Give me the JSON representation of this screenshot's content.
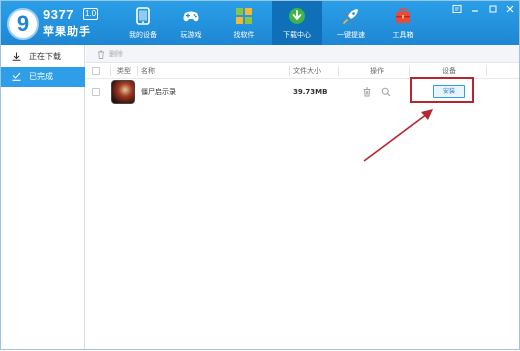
{
  "app": {
    "brand_number": "9377",
    "version": "1.0",
    "brand_name": "苹果助手",
    "logo_glyph": "9",
    "logo_icon": "logo-swirl"
  },
  "nav": [
    {
      "label": "我的设备",
      "icon": "tablet-icon",
      "active": false
    },
    {
      "label": "玩游戏",
      "icon": "gamepad-icon",
      "active": false
    },
    {
      "label": "找软件",
      "icon": "apps-grid-icon",
      "active": false
    },
    {
      "label": "下载中心",
      "icon": "download-icon",
      "active": true
    },
    {
      "label": "一键提速",
      "icon": "rocket-icon",
      "active": false
    },
    {
      "label": "工具箱",
      "icon": "toolbox-icon",
      "active": false
    }
  ],
  "window_controls": [
    "settings-icon",
    "minimize-icon",
    "restore-icon",
    "close-icon"
  ],
  "sidebar": {
    "items": [
      {
        "label": "正在下载",
        "icon": "download-arrow-icon",
        "active": false
      },
      {
        "label": "已完成",
        "icon": "checkmark-tray-icon",
        "active": true
      }
    ]
  },
  "toolbar": {
    "delete_label": "删除",
    "delete_icon": "trash-icon"
  },
  "table": {
    "columns": [
      "类型",
      "名称",
      "文件大小",
      "操作",
      "设备"
    ],
    "rows": [
      {
        "name": "僵尸启示录",
        "size": "39.73MB",
        "action_label": "安装",
        "delete_icon": "trash-icon",
        "locate_icon": "magnifier-icon"
      }
    ]
  },
  "colors": {
    "header_blue": "#1e86d3",
    "active_tab": "#0f6fb8",
    "sidebar_active": "#2f9ee8",
    "highlight_red": "#b8252e"
  }
}
